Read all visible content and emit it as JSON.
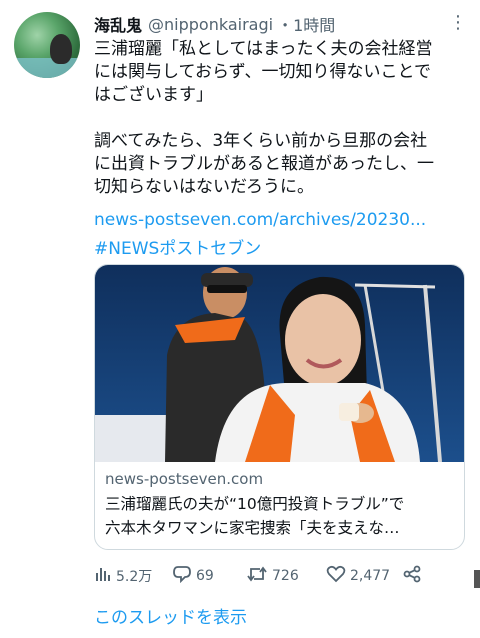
{
  "tweet": {
    "display_name": "海乱鬼",
    "handle": "@nipponkairagi",
    "time": "・1時間",
    "paragraphs": [
      "三浦瑠麗「私としてはまったく夫の会社経営\nには関与しておらず、一切知り得ないことで\nはございます」",
      "調べてみたら、3年くらい前から旦那の会社\nに出資トラブルがあると報道があったし、一\n切知らないはないだろうに。"
    ],
    "link": "news-postseven.com/archives/20230...",
    "hashtag": "#NEWSポストセブン"
  },
  "card": {
    "domain": "news-postseven.com",
    "title_lines": [
      "三浦瑠麗氏の夫が“10億円投資トラブル”で",
      "六本木タワマンに家宅捜索「夫を支えな…"
    ]
  },
  "actions": {
    "views": "5.2万",
    "replies": "69",
    "retweets": "726",
    "likes": "2,477"
  },
  "thread_link": "このスレッドを表示",
  "colors": {
    "accent": "#1d9bf0",
    "muted": "#536471",
    "text": "#0f1419",
    "border": "#cfd9de"
  },
  "icons": [
    "more-icon",
    "views-icon",
    "reply-icon",
    "retweet-icon",
    "like-icon",
    "share-icon"
  ]
}
